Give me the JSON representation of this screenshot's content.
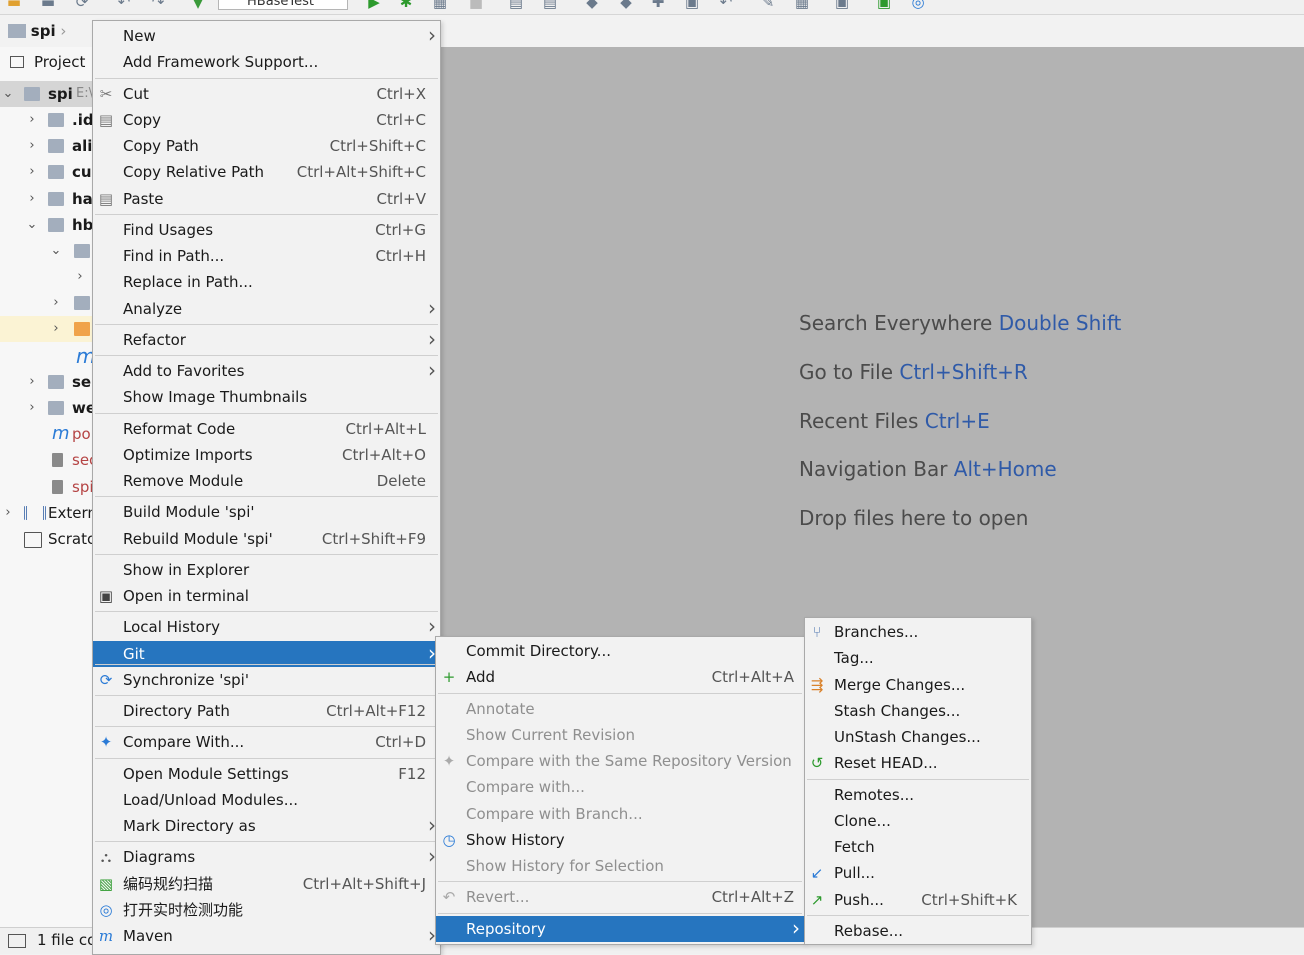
{
  "toolbar": {
    "run_config": "HBaseTest"
  },
  "navbar": {
    "crumb": "spi"
  },
  "project": {
    "tool_window_label": "Project",
    "tree": [
      {
        "label": "spi",
        "suffix": "E:\\"
      },
      {
        "label": ".id"
      },
      {
        "label": "ali"
      },
      {
        "label": "cu"
      },
      {
        "label": "ha"
      },
      {
        "label": "hb"
      },
      {
        "label": ""
      },
      {
        "label": ""
      },
      {
        "label": ""
      },
      {
        "label": ""
      },
      {
        "label": "m"
      },
      {
        "label": "ser"
      },
      {
        "label": "we"
      },
      {
        "label": "po"
      },
      {
        "label": "sec"
      },
      {
        "label": "spi"
      },
      {
        "label": "Extern"
      },
      {
        "label": "Scratc"
      }
    ]
  },
  "editor_hints": [
    {
      "text": "Search Everywhere",
      "key": "Double Shift"
    },
    {
      "text": "Go to File",
      "key": "Ctrl+Shift+R"
    },
    {
      "text": "Recent Files",
      "key": "Ctrl+E"
    },
    {
      "text": "Navigation Bar",
      "key": "Alt+Home"
    },
    {
      "text": "Drop files here to open",
      "key": ""
    }
  ],
  "status": {
    "text": "1 file co"
  },
  "context_menu": {
    "items": [
      {
        "label": "New",
        "submenu": true
      },
      {
        "label": "Add Framework Support..."
      },
      {
        "label": "Cut",
        "shortcut": "Ctrl+X",
        "icon": "cut-icon"
      },
      {
        "label": "Copy",
        "shortcut": "Ctrl+C",
        "icon": "copy-icon"
      },
      {
        "label": "Copy Path",
        "shortcut": "Ctrl+Shift+C"
      },
      {
        "label": "Copy Relative Path",
        "shortcut": "Ctrl+Alt+Shift+C"
      },
      {
        "label": "Paste",
        "shortcut": "Ctrl+V",
        "icon": "paste-icon"
      },
      {
        "label": "Find Usages",
        "shortcut": "Ctrl+G"
      },
      {
        "label": "Find in Path...",
        "shortcut": "Ctrl+H"
      },
      {
        "label": "Replace in Path..."
      },
      {
        "label": "Analyze",
        "submenu": true
      },
      {
        "label": "Refactor",
        "submenu": true
      },
      {
        "label": "Add to Favorites",
        "submenu": true
      },
      {
        "label": "Show Image Thumbnails"
      },
      {
        "label": "Reformat Code",
        "shortcut": "Ctrl+Alt+L"
      },
      {
        "label": "Optimize Imports",
        "shortcut": "Ctrl+Alt+O"
      },
      {
        "label": "Remove Module",
        "shortcut": "Delete"
      },
      {
        "label": "Build Module 'spi'"
      },
      {
        "label": "Rebuild Module 'spi'",
        "shortcut": "Ctrl+Shift+F9"
      },
      {
        "label": "Show in Explorer"
      },
      {
        "label": "Open in terminal",
        "icon": "terminal-icon"
      },
      {
        "label": "Local History",
        "submenu": true
      },
      {
        "label": "Git",
        "submenu": true,
        "selected": true
      },
      {
        "label": "Synchronize 'spi'",
        "icon": "sync-icon"
      },
      {
        "label": "Directory Path",
        "shortcut": "Ctrl+Alt+F12"
      },
      {
        "label": "Compare With...",
        "shortcut": "Ctrl+D",
        "icon": "compare-icon"
      },
      {
        "label": "Open Module Settings",
        "shortcut": "F12"
      },
      {
        "label": "Load/Unload Modules..."
      },
      {
        "label": "Mark Directory as",
        "submenu": true
      },
      {
        "label": "Diagrams",
        "submenu": true,
        "icon": "diagram-icon"
      },
      {
        "label": "编码规约扫描",
        "shortcut": "Ctrl+Alt+Shift+J",
        "icon": "scan-icon"
      },
      {
        "label": "打开实时检测功能",
        "icon": "realtime-check-icon"
      },
      {
        "label": "Maven",
        "submenu": true,
        "icon": "maven-icon"
      }
    ]
  },
  "git_menu": {
    "items": [
      {
        "label": "Commit Directory..."
      },
      {
        "label": "Add",
        "shortcut": "Ctrl+Alt+A",
        "icon": "plus-icon"
      },
      {
        "label": "Annotate",
        "disabled": true
      },
      {
        "label": "Show Current Revision",
        "disabled": true
      },
      {
        "label": "Compare with the Same Repository Version",
        "disabled": true,
        "icon": "compare-icon"
      },
      {
        "label": "Compare with...",
        "disabled": true
      },
      {
        "label": "Compare with Branch...",
        "disabled": true
      },
      {
        "label": "Show History",
        "icon": "history-icon"
      },
      {
        "label": "Show History for Selection",
        "disabled": true
      },
      {
        "label": "Revert...",
        "shortcut": "Ctrl+Alt+Z",
        "disabled": true,
        "icon": "revert-icon"
      },
      {
        "label": "Repository",
        "submenu": true,
        "selected": true
      }
    ]
  },
  "repo_menu": {
    "items": [
      {
        "label": "Branches...",
        "icon": "branch-icon"
      },
      {
        "label": "Tag..."
      },
      {
        "label": "Merge Changes...",
        "icon": "merge-icon"
      },
      {
        "label": "Stash Changes..."
      },
      {
        "label": "UnStash Changes..."
      },
      {
        "label": "Reset HEAD...",
        "icon": "reset-icon"
      },
      {
        "label": "Remotes..."
      },
      {
        "label": "Clone..."
      },
      {
        "label": "Fetch"
      },
      {
        "label": "Pull...",
        "icon": "pull-icon"
      },
      {
        "label": "Push...",
        "shortcut": "Ctrl+Shift+K",
        "icon": "push-icon"
      },
      {
        "label": "Rebase..."
      }
    ]
  }
}
